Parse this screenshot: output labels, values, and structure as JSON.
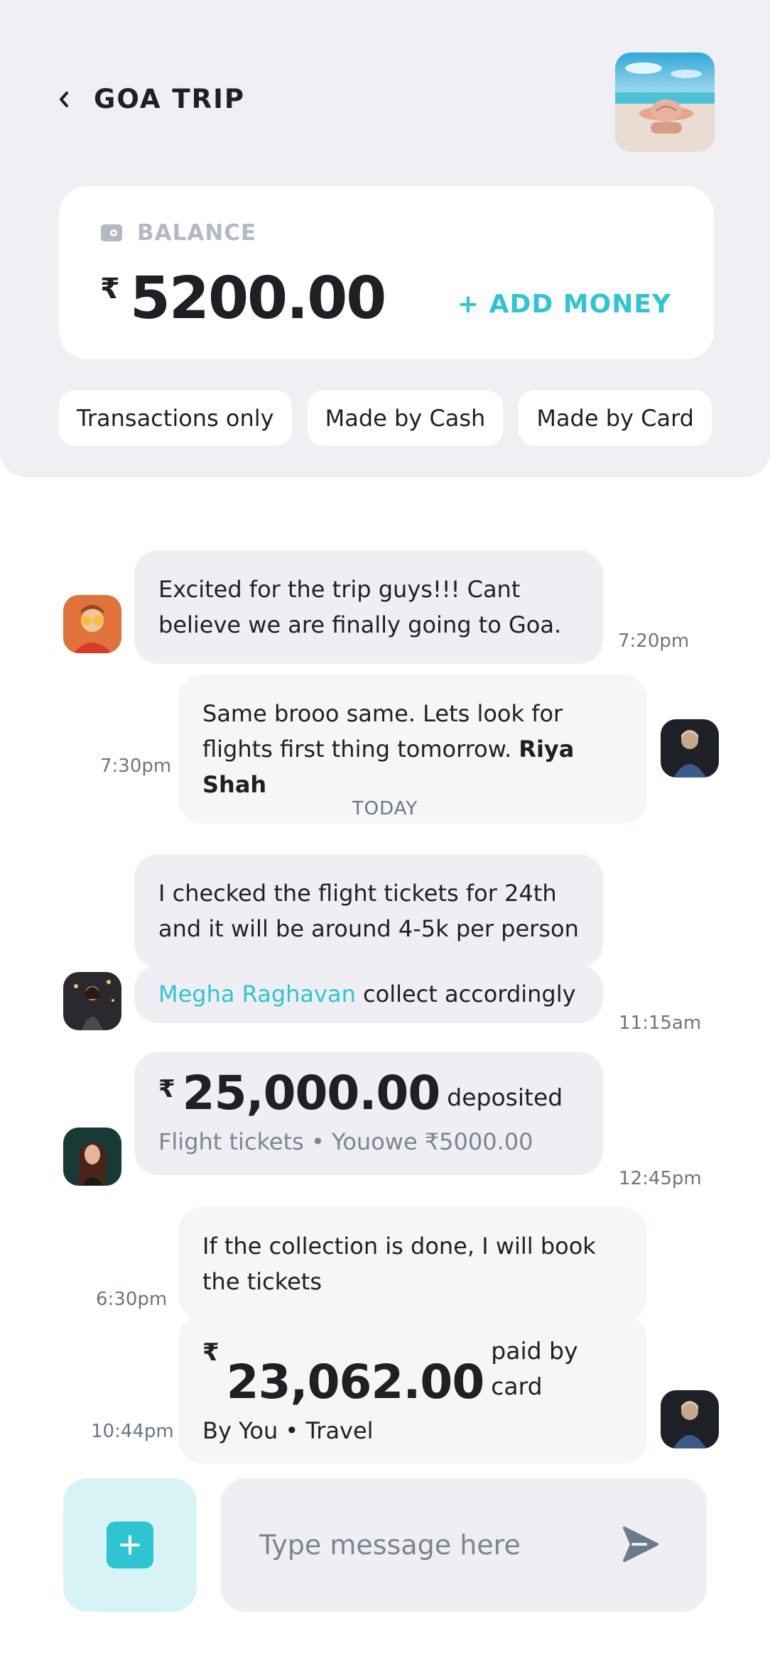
{
  "header": {
    "title": "GOA TRIP",
    "back_icon": "chevron-left-icon",
    "trip_image": "beach-photo"
  },
  "balance": {
    "label": "BALANCE",
    "currency": "₹",
    "amount": "5200.00",
    "add_money_label": "+ ADD MONEY",
    "icon": "wallet-icon"
  },
  "filters": [
    "Transactions only",
    "Made by Cash",
    "Made by Card"
  ],
  "messages": [
    {
      "text": "Excited for the trip guys!!! Cant believe we are finally going to Goa.",
      "time": "7:20pm",
      "direction": "incoming"
    },
    {
      "text": "Same brooo same. Lets look for flights first thing tomorrow.",
      "mention": "Riya Shah",
      "time": "7:30pm",
      "direction": "outgoing"
    },
    {
      "text": "I checked the flight tickets for 24th and it will be around 4-5k per person",
      "direction": "incoming"
    },
    {
      "mention": "Megha Raghavan",
      "text": "collect accordingly",
      "time": "11:15am",
      "direction": "incoming"
    },
    {
      "currency": "₹",
      "amount": "25,000.00",
      "suffix": "deposited",
      "sub": "Flight tickets • Youowe ₹5000.00",
      "time": "12:45pm",
      "direction": "incoming"
    },
    {
      "text": "If the collection is done, I will book the tickets",
      "time": "6:30pm",
      "direction": "outgoing"
    },
    {
      "currency": "₹",
      "amount": "23,062.00",
      "suffix": "paid by card",
      "sub": "By You • Travel",
      "time": "10:44pm",
      "direction": "outgoing"
    }
  ],
  "divider": "TODAY",
  "composer": {
    "placeholder": "Type message here",
    "add_icon": "plus-icon",
    "send_icon": "send-icon"
  },
  "colors": {
    "accent": "#2ec5d3",
    "header_bg": "#f0f0f4",
    "bubble_bg": "#efeff3"
  }
}
